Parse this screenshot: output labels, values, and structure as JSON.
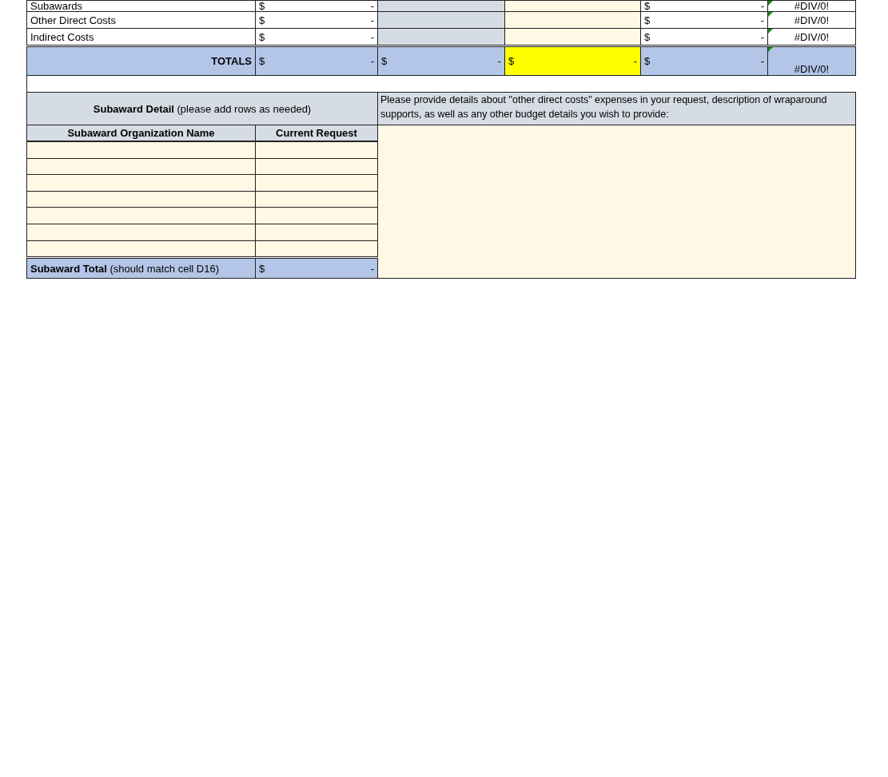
{
  "budget_rows": [
    {
      "label": "Subawards",
      "amount": {
        "symbol": "$",
        "value": "-"
      },
      "projected": {
        "symbol": "$",
        "value": "-"
      },
      "ratio": "#DIV/0!",
      "error_flag": true
    },
    {
      "label": "Other Direct Costs",
      "amount": {
        "symbol": "$",
        "value": "-"
      },
      "projected": {
        "symbol": "$",
        "value": "-"
      },
      "ratio": "#DIV/0!",
      "error_flag": true
    },
    {
      "label": "Indirect Costs",
      "amount": {
        "symbol": "$",
        "value": "-"
      },
      "projected": {
        "symbol": "$",
        "value": "-"
      },
      "ratio": "#DIV/0!",
      "error_flag": true
    }
  ],
  "totals": {
    "label": "TOTALS",
    "cells": [
      {
        "symbol": "$",
        "value": "-",
        "highlighted": false
      },
      {
        "symbol": "$",
        "value": "-",
        "highlighted": false
      },
      {
        "symbol": "$",
        "value": "-",
        "highlighted": true
      },
      {
        "symbol": "$",
        "value": "-",
        "highlighted": false
      }
    ],
    "ratio": "#DIV/0!",
    "error_flag": true
  },
  "subaward_detail": {
    "title": "**Subaward Detail** (please add rows as needed)",
    "columns": [
      "Subaward Organization Name",
      "Current Request"
    ],
    "total_label": "**Subaward Total** (should match cell D16)",
    "total": {
      "symbol": "$",
      "value": "-"
    }
  },
  "details_prompt": "Please provide details about \"other direct costs\" expenses in your request, description of wraparound supports, as well as any other budget details you wish to provide:"
}
